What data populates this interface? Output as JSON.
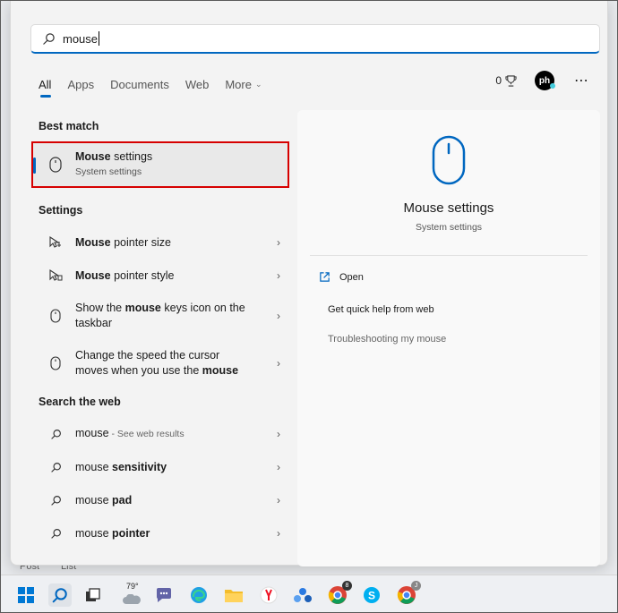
{
  "search": {
    "value": "mouse"
  },
  "tabs": [
    {
      "label": "All"
    },
    {
      "label": "Apps"
    },
    {
      "label": "Documents"
    },
    {
      "label": "Web"
    },
    {
      "label": "More"
    }
  ],
  "header_right": {
    "points": "0"
  },
  "avatar_text": "ph",
  "left": {
    "best_match_title": "Best match",
    "best_match": {
      "title_bold": "Mouse",
      "title_rest": " settings",
      "subtitle": "System settings"
    },
    "settings_title": "Settings",
    "settings_items": [
      {
        "bold": "Mouse",
        "rest": " pointer size"
      },
      {
        "bold": "Mouse",
        "rest": " pointer style"
      },
      {
        "pre": "Show the ",
        "bold": "mouse",
        "post": " keys icon on the taskbar"
      },
      {
        "pre": "Change the speed the cursor moves when you use the ",
        "bold": "mouse",
        "post": ""
      }
    ],
    "web_title": "Search the web",
    "web_items": [
      {
        "text": "mouse",
        "suffix": " - See web results"
      },
      {
        "text": "mouse ",
        "bold": "sensitivity"
      },
      {
        "text": "mouse ",
        "bold": "pad"
      },
      {
        "text": "mouse ",
        "bold": "pointer"
      }
    ]
  },
  "preview": {
    "title": "Mouse settings",
    "subtitle": "System settings",
    "actions": [
      {
        "label": "Open"
      },
      {
        "label": "Get quick help from web"
      },
      {
        "label": "Troubleshooting my mouse"
      }
    ]
  },
  "background": {
    "text1": "Post",
    "text2": "List"
  },
  "taskbar": {
    "weather": "79°",
    "badge1": "8",
    "badge2": "J"
  },
  "colors": {
    "accent": "#0067c0",
    "highlight_border": "#d60000"
  }
}
